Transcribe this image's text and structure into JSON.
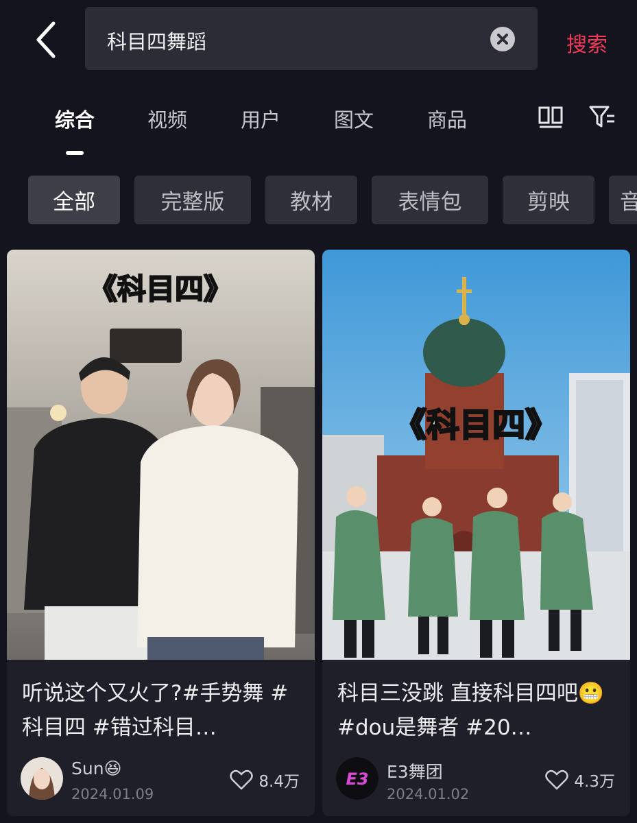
{
  "search": {
    "query": "科目四舞蹈",
    "button_label": "搜索"
  },
  "tabs": [
    {
      "label": "综合",
      "active": true
    },
    {
      "label": "视频"
    },
    {
      "label": "用户"
    },
    {
      "label": "图文"
    },
    {
      "label": "商品"
    }
  ],
  "chips": [
    {
      "label": "全部",
      "active": true
    },
    {
      "label": "完整版"
    },
    {
      "label": "教材"
    },
    {
      "label": "表情包"
    },
    {
      "label": "剪映"
    },
    {
      "label": "音"
    }
  ],
  "results": [
    {
      "overlay_title": "《科目四》",
      "title": "听说这个又火了?#手势舞 #科目四 #错过科目…",
      "author": "Sun😆",
      "date": "2024.01.09",
      "likes": "8.4万"
    },
    {
      "overlay_title": "《科目四》",
      "title": "科目三没跳  直接科目四吧😬 #dou是舞者 #20…",
      "author": "E3舞团",
      "date": "2024.01.02",
      "likes": "4.3万",
      "avatar_text": "E3"
    }
  ],
  "colors": {
    "background": "#13141d",
    "accent": "#f03a57",
    "card": "#1e1f28"
  }
}
